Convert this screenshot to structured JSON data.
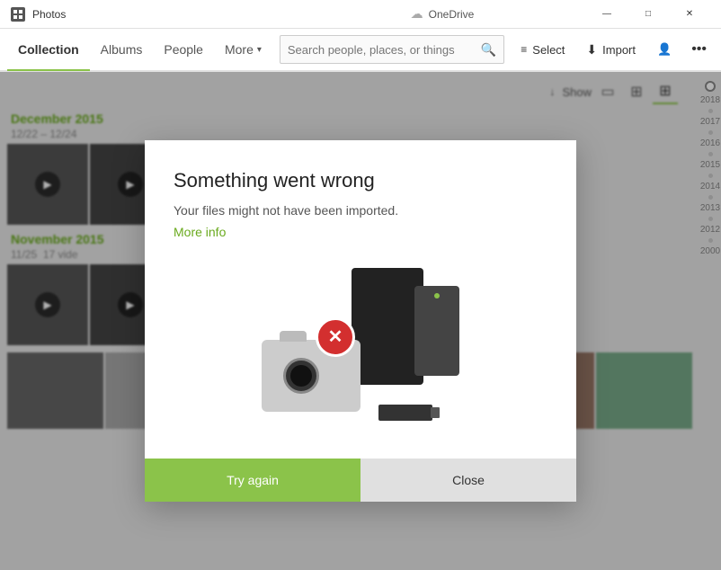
{
  "app": {
    "title": "Photos",
    "onedrive_label": "OneDrive"
  },
  "titlebar": {
    "minimize": "—",
    "maximize": "□",
    "close": "✕"
  },
  "nav": {
    "tabs": [
      {
        "id": "collection",
        "label": "Collection",
        "active": true
      },
      {
        "id": "albums",
        "label": "Albums",
        "active": false
      },
      {
        "id": "people",
        "label": "People",
        "active": false
      },
      {
        "id": "more",
        "label": "More",
        "active": false,
        "has_chevron": true
      }
    ],
    "search_placeholder": "Search people, places, or things",
    "select_label": "Select",
    "import_label": "Import"
  },
  "toolbar": {
    "show_label": "Show"
  },
  "timeline": {
    "years": [
      "2018",
      "2017",
      "2016",
      "2015",
      "2014",
      "2013",
      "2012",
      "2000"
    ]
  },
  "sections": [
    {
      "title": "December 2015",
      "date_range": "12/22 – 12/24"
    },
    {
      "title": "November 2015",
      "date_range": "11/25",
      "extra": "17 vide"
    }
  ],
  "dialog": {
    "title": "Something went wrong",
    "message": "Your files might not have been imported.",
    "more_info_label": "More info",
    "try_again_label": "Try again",
    "close_label": "Close"
  }
}
